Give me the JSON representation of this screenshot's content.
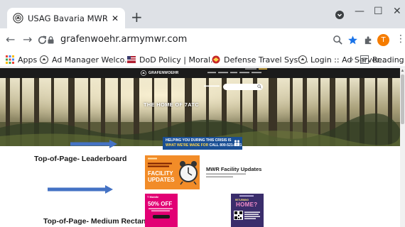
{
  "browser": {
    "tab": {
      "title": "USAG Bavaria MWR | Serving Gra",
      "close": "✕"
    },
    "new_tab": "+",
    "window_controls": {
      "minimize": "—",
      "maximize": "☐",
      "close": "✕"
    },
    "profile_initial": "T",
    "url": "grafenwoehr.armymwr.com",
    "nav": {
      "back": "←",
      "forward": "→",
      "reload": "C"
    },
    "bookmarks": [
      {
        "label": "Apps",
        "icon": "apps-grid-icon"
      },
      {
        "label": "Ad Manager Welco...",
        "icon": "army-seal-icon"
      },
      {
        "label": "DoD Policy | Moral...",
        "icon": "flag-icon"
      },
      {
        "label": "Defense Travel Syst...",
        "icon": "eagle-icon"
      },
      {
        "label": "Login :: Ad Server...",
        "icon": "army-seal-icon"
      }
    ],
    "bookmarks_more": "»",
    "reading_list": "Reading list"
  },
  "site": {
    "logo_text": "GRAFENWOEHR",
    "hero_title": "THE HOME OF 7ATC",
    "colors": {
      "brand_dark": "#1b1b1b",
      "crisis_blue": "#1a4f95",
      "mwr_orange": "#f28c28",
      "tmobile_pink": "#e20074"
    }
  },
  "ads": {
    "crisis": {
      "line1": "HELPING YOU DURING THIS CRISIS IS",
      "line2": "WHAT WE'RE MADE FOR",
      "phone": "CALL 800-521-8921"
    },
    "leaderboard_label": "Top-of-Page- Leaderboard",
    "mwr_facility": {
      "headline": "FACILITY UPDATES",
      "title": "MWR Facility Updates"
    },
    "tmobile": {
      "brand": "T Mobile",
      "offer": "50% OFF"
    },
    "homes": {
      "line1": "RETURNING",
      "line2": "HOME?"
    },
    "medium_rect_label": "Top-of-Page- Medium Rectangle"
  }
}
